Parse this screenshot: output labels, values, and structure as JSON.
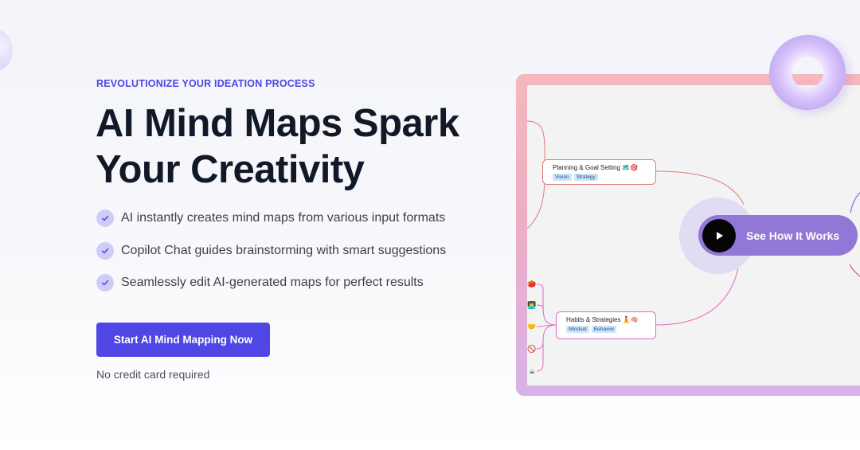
{
  "hero": {
    "eyebrow": "REVOLUTIONIZE YOUR IDEATION PROCESS",
    "headline_line1": "AI Mind Maps Spark",
    "headline_line2": "Your Creativity",
    "features": [
      "AI instantly creates mind maps from various input formats",
      "Copilot Chat guides brainstorming with smart suggestions",
      "Seamlessly edit AI-generated maps for perfect results"
    ],
    "cta_label": "Start AI Mind Mapping Now",
    "note": "No credit card required"
  },
  "preview": {
    "video_button_label": "See How It Works",
    "nodes": {
      "planning": {
        "title": "Planning & Goal Setting 🗺️🎯",
        "tags": [
          "Vision",
          "Strategy"
        ]
      },
      "habits": {
        "title": "Habits & Strategies 🧘🧠",
        "tags": [
          "Mindset",
          "Behavior"
        ]
      }
    },
    "leaf_emojis": [
      "🍅",
      "👨‍💻",
      "🤝",
      "🚫",
      "☕"
    ]
  },
  "colors": {
    "accent": "#4f46e5",
    "check_bg": "#cfcdf6",
    "video_pill": "#9278d6"
  }
}
